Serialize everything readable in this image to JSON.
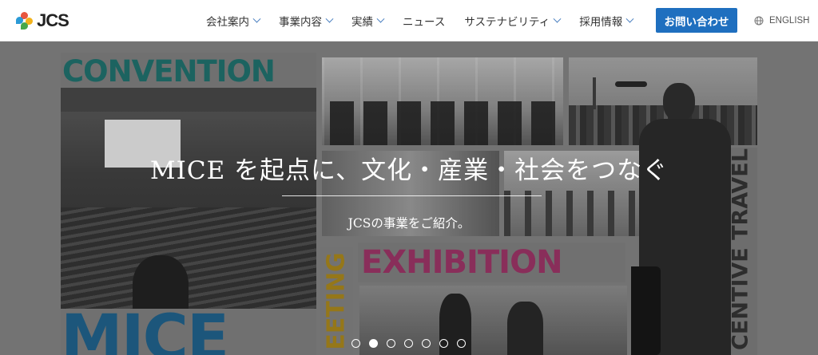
{
  "header": {
    "logo_text": "JCS",
    "nav": [
      {
        "label": "会社案内",
        "dropdown": true
      },
      {
        "label": "事業内容",
        "dropdown": true
      },
      {
        "label": "実績",
        "dropdown": true
      },
      {
        "label": "ニュース",
        "dropdown": false
      },
      {
        "label": "サステナビリティ",
        "dropdown": true
      },
      {
        "label": "採用情報",
        "dropdown": true
      }
    ],
    "contact_label": "お問い合わせ",
    "lang_label": "ENGLISH"
  },
  "hero": {
    "title": "MICE を起点に、文化・産業・社会をつなぐ",
    "subtitle": "JCSの事業をご紹介。",
    "words": {
      "convention": "CONVENTION",
      "exhibition": "EXHIBITION",
      "mice": "MICE",
      "meeting": "EETING",
      "incentive": "CENTIVE TRAVEL"
    },
    "slides_count": 7,
    "active_slide": 2
  },
  "colors": {
    "brand_blue": "#1f6fbf",
    "convention_teal": "#1a6e6a",
    "exhibition_magenta": "#9b2f63",
    "mice_blue": "#1a5f8a",
    "meeting_gold": "#a88517"
  }
}
